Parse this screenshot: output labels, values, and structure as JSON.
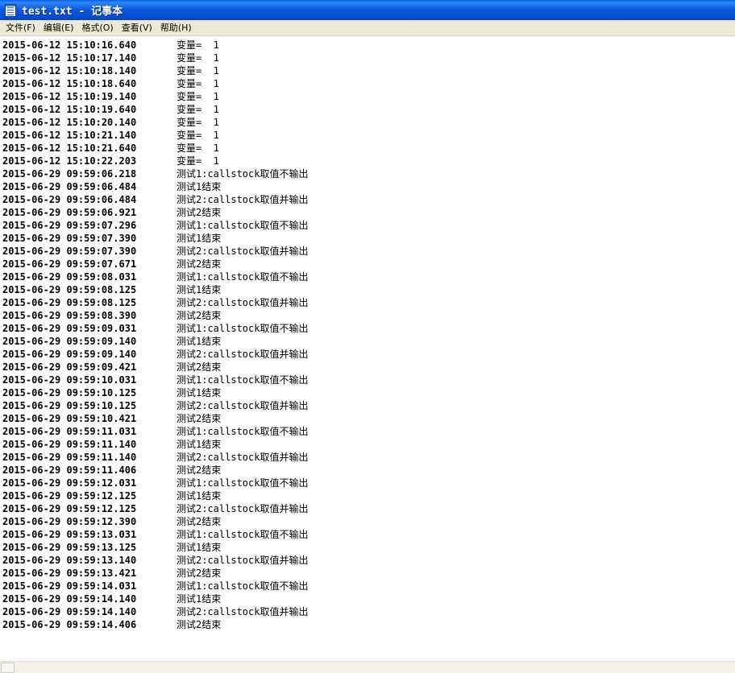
{
  "window": {
    "title": "test.txt - 记事本"
  },
  "menu": [
    {
      "label": "文件(F)"
    },
    {
      "label": "编辑(E)"
    },
    {
      "label": "格式(O)"
    },
    {
      "label": "查看(V)"
    },
    {
      "label": "帮助(H)"
    }
  ],
  "lines": [
    {
      "ts": "2015-06-12 15:10:16.640",
      "msg": "变量=  1"
    },
    {
      "ts": "2015-06-12 15:10:17.140",
      "msg": "变量=  1"
    },
    {
      "ts": "2015-06-12 15:10:18.140",
      "msg": "变量=  1"
    },
    {
      "ts": "2015-06-12 15:10:18.640",
      "msg": "变量=  1"
    },
    {
      "ts": "2015-06-12 15:10:19.140",
      "msg": "变量=  1"
    },
    {
      "ts": "2015-06-12 15:10:19.640",
      "msg": "变量=  1"
    },
    {
      "ts": "2015-06-12 15:10:20.140",
      "msg": "变量=  1"
    },
    {
      "ts": "2015-06-12 15:10:21.140",
      "msg": "变量=  1"
    },
    {
      "ts": "2015-06-12 15:10:21.640",
      "msg": "变量=  1"
    },
    {
      "ts": "2015-06-12 15:10:22.203",
      "msg": "变量=  1"
    },
    {
      "ts": "2015-06-29 09:59:06.218",
      "msg": "测试1:callstock取值不输出"
    },
    {
      "ts": "2015-06-29 09:59:06.484",
      "msg": "测试1结束"
    },
    {
      "ts": "2015-06-29 09:59:06.484",
      "msg": "测试2:callstock取值并输出"
    },
    {
      "ts": "2015-06-29 09:59:06.921",
      "msg": "测试2结束"
    },
    {
      "ts": "2015-06-29 09:59:07.296",
      "msg": "测试1:callstock取值不输出"
    },
    {
      "ts": "2015-06-29 09:59:07.390",
      "msg": "测试1结束"
    },
    {
      "ts": "2015-06-29 09:59:07.390",
      "msg": "测试2:callstock取值并输出"
    },
    {
      "ts": "2015-06-29 09:59:07.671",
      "msg": "测试2结束"
    },
    {
      "ts": "2015-06-29 09:59:08.031",
      "msg": "测试1:callstock取值不输出"
    },
    {
      "ts": "2015-06-29 09:59:08.125",
      "msg": "测试1结束"
    },
    {
      "ts": "2015-06-29 09:59:08.125",
      "msg": "测试2:callstock取值并输出"
    },
    {
      "ts": "2015-06-29 09:59:08.390",
      "msg": "测试2结束"
    },
    {
      "ts": "2015-06-29 09:59:09.031",
      "msg": "测试1:callstock取值不输出"
    },
    {
      "ts": "2015-06-29 09:59:09.140",
      "msg": "测试1结束"
    },
    {
      "ts": "2015-06-29 09:59:09.140",
      "msg": "测试2:callstock取值并输出"
    },
    {
      "ts": "2015-06-29 09:59:09.421",
      "msg": "测试2结束"
    },
    {
      "ts": "2015-06-29 09:59:10.031",
      "msg": "测试1:callstock取值不输出"
    },
    {
      "ts": "2015-06-29 09:59:10.125",
      "msg": "测试1结束"
    },
    {
      "ts": "2015-06-29 09:59:10.125",
      "msg": "测试2:callstock取值并输出"
    },
    {
      "ts": "2015-06-29 09:59:10.421",
      "msg": "测试2结束"
    },
    {
      "ts": "2015-06-29 09:59:11.031",
      "msg": "测试1:callstock取值不输出"
    },
    {
      "ts": "2015-06-29 09:59:11.140",
      "msg": "测试1结束"
    },
    {
      "ts": "2015-06-29 09:59:11.140",
      "msg": "测试2:callstock取值并输出"
    },
    {
      "ts": "2015-06-29 09:59:11.406",
      "msg": "测试2结束"
    },
    {
      "ts": "2015-06-29 09:59:12.031",
      "msg": "测试1:callstock取值不输出"
    },
    {
      "ts": "2015-06-29 09:59:12.125",
      "msg": "测试1结束"
    },
    {
      "ts": "2015-06-29 09:59:12.125",
      "msg": "测试2:callstock取值并输出"
    },
    {
      "ts": "2015-06-29 09:59:12.390",
      "msg": "测试2结束"
    },
    {
      "ts": "2015-06-29 09:59:13.031",
      "msg": "测试1:callstock取值不输出"
    },
    {
      "ts": "2015-06-29 09:59:13.125",
      "msg": "测试1结束"
    },
    {
      "ts": "2015-06-29 09:59:13.140",
      "msg": "测试2:callstock取值并输出"
    },
    {
      "ts": "2015-06-29 09:59:13.421",
      "msg": "测试2结束"
    },
    {
      "ts": "2015-06-29 09:59:14.031",
      "msg": "测试1:callstock取值不输出"
    },
    {
      "ts": "2015-06-29 09:59:14.140",
      "msg": "测试1结束"
    },
    {
      "ts": "2015-06-29 09:59:14.140",
      "msg": "测试2:callstock取值并输出"
    },
    {
      "ts": "2015-06-29 09:59:14.406",
      "msg": "测试2结束"
    }
  ]
}
